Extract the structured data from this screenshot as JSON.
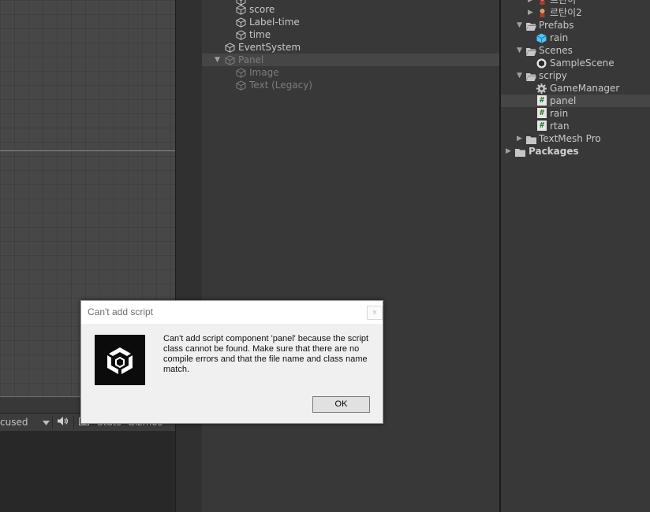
{
  "scene_view": {
    "toolbar": {
      "focus_text": "cused",
      "audio_icon": "speaker-icon",
      "stats_label": "Stats",
      "gizmos_label": "Gizmos"
    }
  },
  "hierarchy": {
    "items": [
      {
        "label": "score"
      },
      {
        "label": "Label-time"
      },
      {
        "label": "time"
      },
      {
        "label": "EventSystem"
      },
      {
        "label": "Panel"
      },
      {
        "label": "Image"
      },
      {
        "label": "Text (Legacy)"
      }
    ]
  },
  "project": {
    "items": [
      {
        "label": "르탄이"
      },
      {
        "label": "르탄이2"
      },
      {
        "label": "Prefabs"
      },
      {
        "label": "rain"
      },
      {
        "label": "Scenes"
      },
      {
        "label": "SampleScene"
      },
      {
        "label": "scripy"
      },
      {
        "label": "GameManager"
      },
      {
        "label": "panel"
      },
      {
        "label": "rain"
      },
      {
        "label": "rtan"
      },
      {
        "label": "TextMesh Pro"
      },
      {
        "label": "Packages"
      }
    ]
  },
  "dialog": {
    "title": "Can't add script",
    "message": "Can't add script component 'panel' because the script class cannot be found. Make sure that there are no compile errors and that the file name and class name match.",
    "ok_label": "OK",
    "close_glyph": "×"
  },
  "colors": {
    "panel_bg": "#383838",
    "selected_row": "#464646",
    "dialog_bg": "#f0f0f0",
    "script_icon_green": "#2e7d32"
  }
}
